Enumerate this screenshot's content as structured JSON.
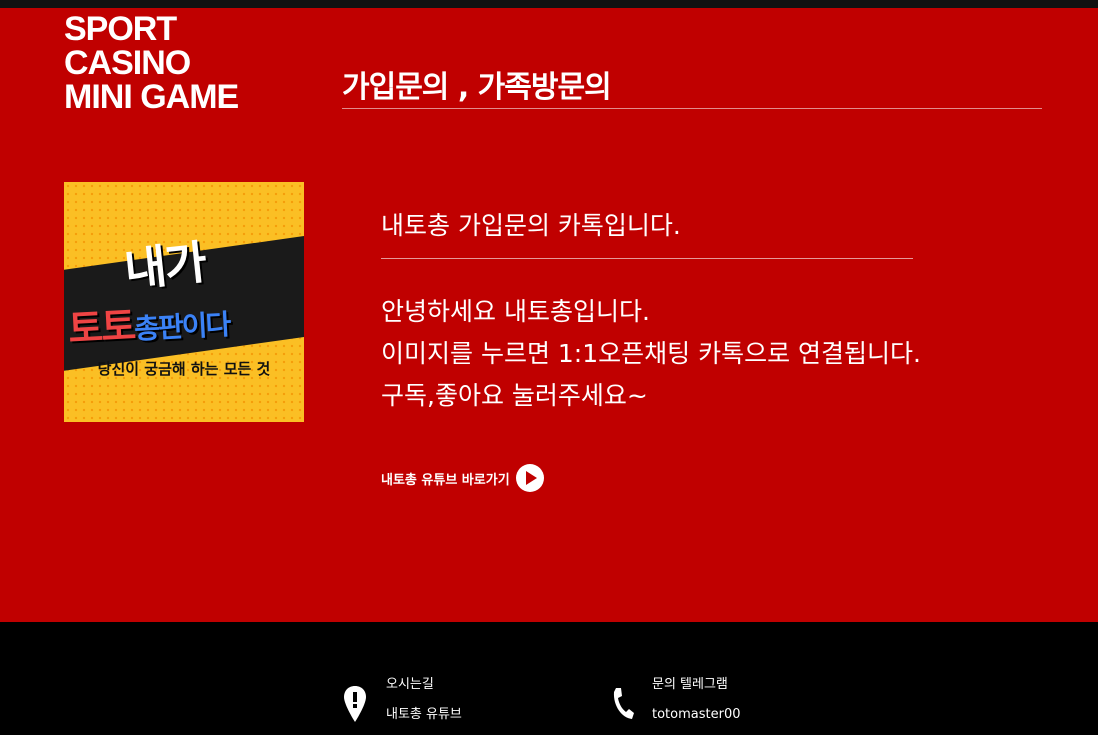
{
  "brand": {
    "logo_lines": [
      "SPORT",
      "CASINO",
      "MINI GAME"
    ]
  },
  "page": {
    "title": "가입문의 , 가족방문의"
  },
  "promo": {
    "line1": "내가",
    "line2_main": "토토",
    "line2_accent": "총판이다",
    "caption": "당신이 궁금해 하는 모든 것"
  },
  "content": {
    "heading": "내토총 가입문의 카톡입니다.",
    "lines": [
      "안녕하세요 내토총입니다.",
      "이미지를 누르면 1:1오픈채팅 카톡으로 연결됩니다.",
      "구독,좋아요 눌러주세요~"
    ],
    "youtube_link_label": "내토총 유튜브 바로가기"
  },
  "footer": {
    "location": {
      "label": "오시는길",
      "value": "내토총 유튜브",
      "icon": "map-pin-icon"
    },
    "telegram": {
      "label": "문의 텔레그램",
      "value": "totomaster00",
      "icon": "phone-icon"
    }
  },
  "colors": {
    "background": "#c00000",
    "footer": "#000000",
    "promo_yellow": "#fbbf24"
  }
}
